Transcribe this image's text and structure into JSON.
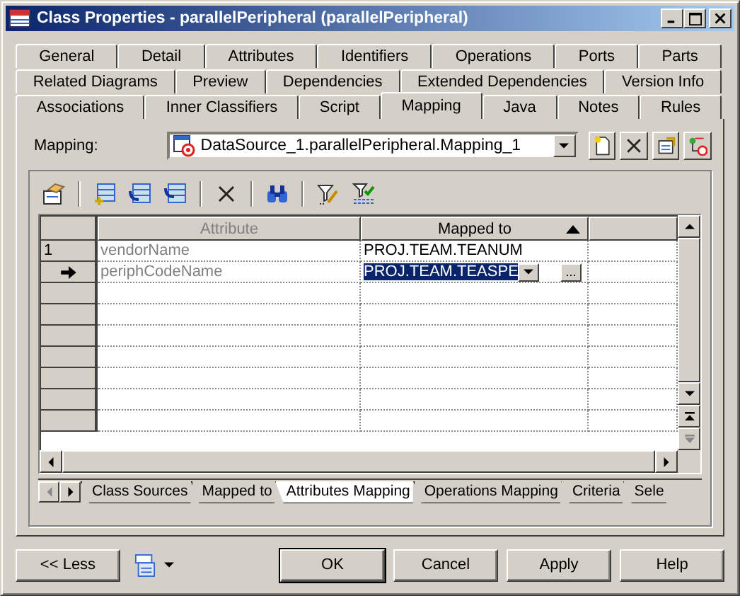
{
  "window": {
    "title": "Class Properties - parallelPeripheral (parallelPeripheral)"
  },
  "tab_rows": [
    [
      {
        "label": "General",
        "selected": false
      },
      {
        "label": "Detail",
        "selected": false
      },
      {
        "label": "Attributes",
        "selected": false
      },
      {
        "label": "Identifiers",
        "selected": false
      },
      {
        "label": "Operations",
        "selected": false
      },
      {
        "label": "Ports",
        "selected": false
      },
      {
        "label": "Parts",
        "selected": false
      }
    ],
    [
      {
        "label": "Related Diagrams",
        "selected": false
      },
      {
        "label": "Preview",
        "selected": false
      },
      {
        "label": "Dependencies",
        "selected": false
      },
      {
        "label": "Extended Dependencies",
        "selected": false
      },
      {
        "label": "Version Info",
        "selected": false
      }
    ],
    [
      {
        "label": "Associations",
        "selected": false
      },
      {
        "label": "Inner Classifiers",
        "selected": false
      },
      {
        "label": "Script",
        "selected": false
      },
      {
        "label": "Mapping",
        "selected": true
      },
      {
        "label": "Java",
        "selected": false
      },
      {
        "label": "Notes",
        "selected": false
      },
      {
        "label": "Rules",
        "selected": false
      }
    ]
  ],
  "mapping": {
    "label": "Mapping:",
    "value": "DataSource_1.parallelPeripheral.Mapping_1"
  },
  "grid": {
    "columns": [
      {
        "label": "Attribute",
        "disabled": true,
        "sorted": false
      },
      {
        "label": "Mapped to",
        "disabled": false,
        "sorted": true
      }
    ],
    "rows": [
      {
        "row_header": "1",
        "attribute": "vendorName",
        "mapped_to": "PROJ.TEAM.TEANUM",
        "current": false
      },
      {
        "attribute": "periphCodeName",
        "mapped_to": "PROJ.TEAM.TEASPE",
        "current": true,
        "browse_button": "..."
      }
    ]
  },
  "sheet_tabs": [
    {
      "label": "Class Sources",
      "selected": false
    },
    {
      "label": "Mapped to",
      "selected": false
    },
    {
      "label": "Attributes Mapping",
      "selected": true
    },
    {
      "label": "Operations Mapping",
      "selected": false
    },
    {
      "label": "Criteria",
      "selected": false
    },
    {
      "label": "Sele",
      "selected": false
    }
  ],
  "buttons": [
    {
      "label": "OK",
      "default": true
    },
    {
      "label": "Cancel",
      "default": false
    },
    {
      "label": "Apply",
      "default": false
    },
    {
      "label": "Help",
      "default": false
    }
  ],
  "less_button": "<< Less"
}
